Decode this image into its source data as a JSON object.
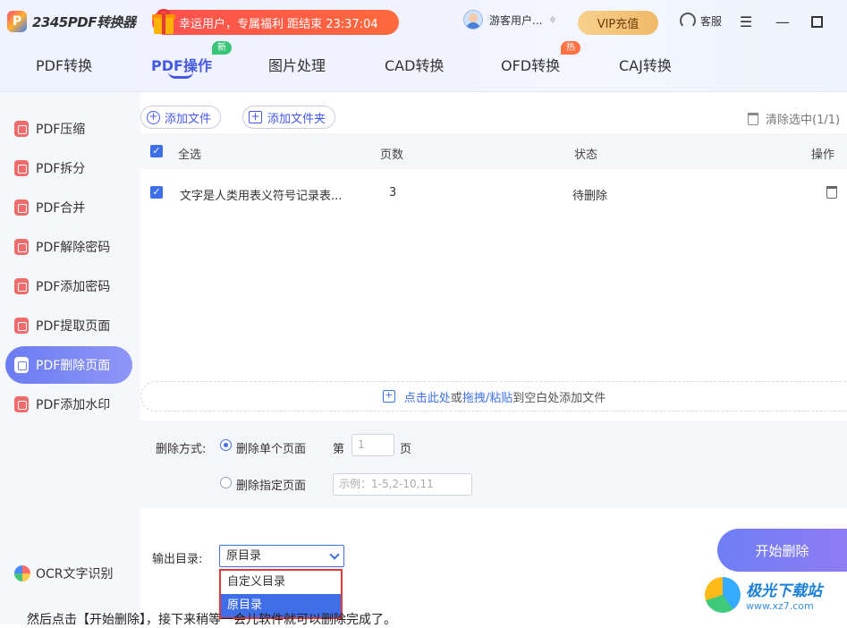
{
  "app": {
    "logo_text": "2345PDF转换器",
    "promo_text": "幸运用户，专属福利 距结束 23:37:04",
    "user_name": "游客用户...",
    "vip_label": "VIP充值",
    "service_label": "客服"
  },
  "tabs": [
    {
      "label": "PDF转换"
    },
    {
      "label": "PDF操作",
      "badge": "新"
    },
    {
      "label": "图片处理"
    },
    {
      "label": "CAD转换"
    },
    {
      "label": "OFD转换",
      "badge": "热"
    },
    {
      "label": "CAJ转换"
    }
  ],
  "sidebar": {
    "items": [
      {
        "label": "PDF压缩"
      },
      {
        "label": "PDF拆分"
      },
      {
        "label": "PDF合并"
      },
      {
        "label": "PDF解除密码"
      },
      {
        "label": "PDF添加密码"
      },
      {
        "label": "PDF提取页面"
      },
      {
        "label": "PDF删除页面"
      },
      {
        "label": "PDF添加水印"
      }
    ],
    "ocr_label": "OCR文字识别"
  },
  "toolbar": {
    "add_file": "添加文件",
    "add_folder": "添加文件夹",
    "clear_selected": "清除选中(1/1)"
  },
  "table": {
    "headers": {
      "select_all": "全选",
      "pages": "页数",
      "status": "状态",
      "action": "操作"
    },
    "rows": [
      {
        "name": "文字是人类用表义符号记录表...",
        "pages": "3",
        "status": "待删除"
      }
    ]
  },
  "dropzone": {
    "click_here": "点击此处",
    "or": "或",
    "drag_paste": "拖拽/粘贴",
    "suffix": "到空白处添加文件"
  },
  "options": {
    "mode_label": "删除方式:",
    "single_label": "删除单个页面",
    "page_prefix": "第",
    "page_value": "1",
    "page_suffix": "页",
    "range_label": "删除指定页面",
    "range_placeholder": "示例：1-5,2-10,11"
  },
  "output": {
    "label": "输出目录:",
    "selected": "原目录",
    "options": [
      "自定义目录",
      "原目录"
    ]
  },
  "start_button": "开始删除",
  "caption": "然后点击【开始删除】，接下来稍等一会儿软件就可以删除完成了。",
  "watermark": {
    "title": "极光下载站",
    "url": "www.xz7.com"
  }
}
